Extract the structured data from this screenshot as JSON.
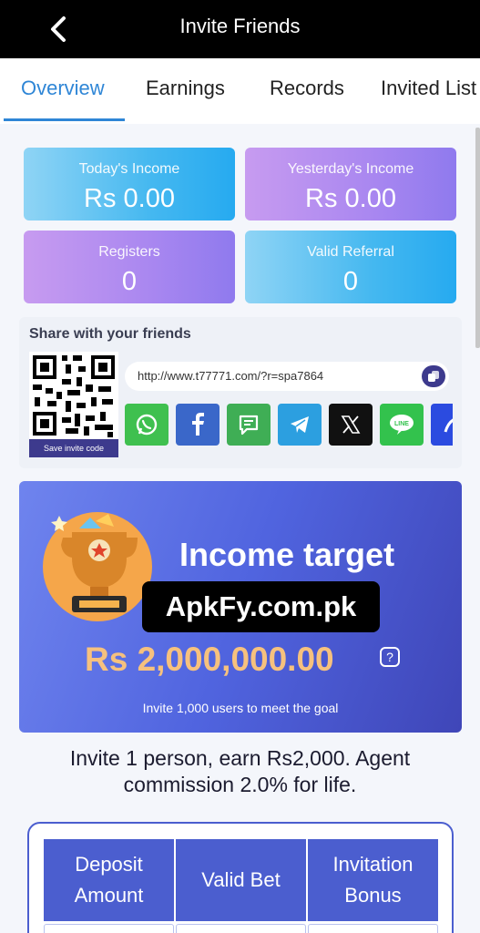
{
  "header": {
    "title": "Invite Friends"
  },
  "tabs": [
    {
      "label": "Overview",
      "active": true
    },
    {
      "label": "Earnings"
    },
    {
      "label": "Records"
    },
    {
      "label": "Invited List"
    }
  ],
  "stats": {
    "today_label": "Today's Income",
    "today_value": "Rs 0.00",
    "yesterday_label": "Yesterday's Income",
    "yesterday_value": "Rs 0.00",
    "registers_label": "Registers",
    "registers_value": "0",
    "valid_label": "Valid Referral",
    "valid_value": "0"
  },
  "share": {
    "title": "Share with your friends",
    "save_label": "Save invite code",
    "link": "http://www.t77771.com/?r=spa7864",
    "social": [
      "whatsapp-icon",
      "facebook-icon",
      "sms-icon",
      "telegram-icon",
      "x-icon",
      "line-icon",
      "more-share-icon"
    ]
  },
  "target": {
    "title": "Income target",
    "watermark": "ApkFy.com.pk",
    "amount": "Rs 2,000,000.00",
    "help": "?",
    "subtitle": "Invite 1,000 users to meet the goal"
  },
  "invite": {
    "line1": "Invite 1 person, earn Rs2,000. Agent",
    "line2": "commission 2.0% for life."
  },
  "table": {
    "col1": "Deposit Amount",
    "col2": "Valid Bet",
    "col3": "Invitation Bonus"
  },
  "colors": {
    "accent": "#2f86d6",
    "dark_purple": "#3d3a8d",
    "table_blue": "#4b5ecf",
    "gold": "#f6c17e"
  }
}
